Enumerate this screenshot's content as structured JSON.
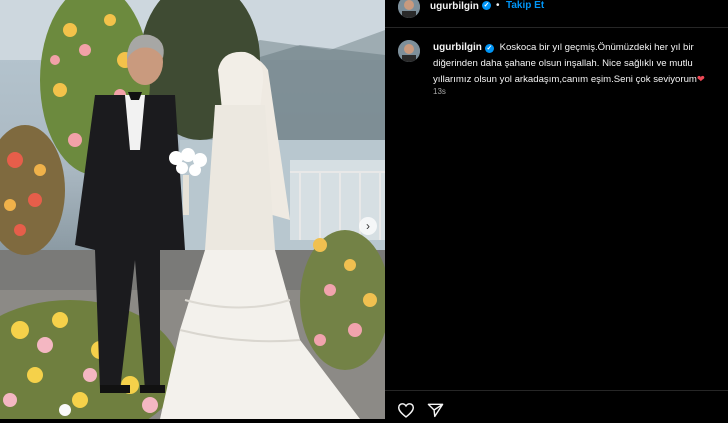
{
  "post": {
    "username": "ugurbilgin",
    "verified_symbol": "✓",
    "separator": "•",
    "follow_label": "Takip Et",
    "caption": "Koskoca bir yıl geçmiş.Önümüzdeki her yıl bir diğerinden daha şahane olsun inşallah. Nice sağlıklı ve mutlu yıllarımız olsun yol arkadaşım,canım eşim.Seni çok seviyorum",
    "caption_emoji": "❤",
    "timestamp": "13s"
  },
  "photo": {
    "alt": "Wedding photo of a couple in front of flower arrangements",
    "next_icon": "chevron-right-icon"
  },
  "actions": {
    "like_icon": "heart-icon",
    "share_icon": "send-icon"
  },
  "colors": {
    "background": "#000000",
    "text": "#f5f5f5",
    "accent": "#0095f6",
    "muted": "#a8a8a8",
    "heart": "#ed4956"
  }
}
